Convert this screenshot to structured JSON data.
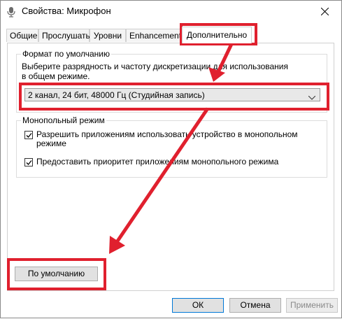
{
  "window": {
    "title": "Свойства: Микрофон"
  },
  "tabs": [
    {
      "label": "Общие"
    },
    {
      "label": "Прослушать"
    },
    {
      "label": "Уровни"
    },
    {
      "label": "Enhancements"
    },
    {
      "label": "Дополнительно",
      "active": true
    }
  ],
  "default_format": {
    "legend": "Формат по умолчанию",
    "description": "Выберите разрядность и частоту дискретизации для использования в общем режиме.",
    "selected_value": "2 канал, 24 бит, 48000 Гц (Студийная запись)"
  },
  "exclusive_mode": {
    "legend": "Монопольный режим",
    "options": [
      {
        "label_line1": "Разрешить приложениям использовать устройство в монопольном",
        "label_line2": "режиме",
        "checked": true
      },
      {
        "label_line1": "Предоставить приоритет приложениям монопольного режима",
        "checked": true
      }
    ]
  },
  "buttons": {
    "restore_defaults": "По умолчанию",
    "ok": "ОК",
    "cancel": "Отмена",
    "apply": "Применить"
  },
  "colors": {
    "annotation_red": "#e0202e",
    "accent_blue": "#0078d7"
  },
  "icons": {
    "title": "microphone-icon",
    "close": "close-icon",
    "dropdown": "chevron-down-icon",
    "check": "checkmark-icon"
  }
}
